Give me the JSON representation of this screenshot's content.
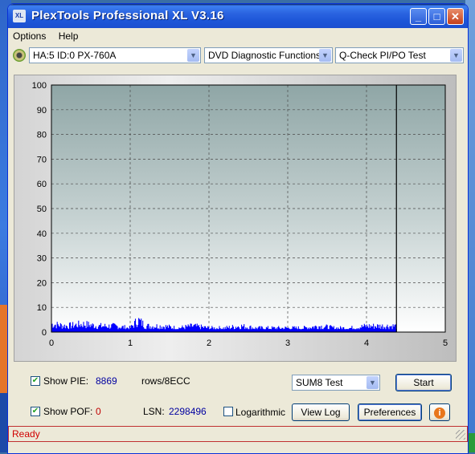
{
  "window": {
    "title": "PlexTools Professional XL V3.16",
    "title_icon": "XL"
  },
  "menu": [
    "Options",
    "Help"
  ],
  "toolbar": {
    "drive": "HA:5 ID:0  PX-760A",
    "functions": "DVD Diagnostic Functions",
    "test": "Q-Check PI/PO Test"
  },
  "chart_data": {
    "type": "line",
    "title": "",
    "xlabel": "",
    "ylabel": "",
    "xlim": [
      0,
      5
    ],
    "ylim": [
      0,
      100
    ],
    "x_ticks": [
      "0",
      "1",
      "2",
      "3",
      "4",
      "5"
    ],
    "y_ticks": [
      "0",
      "10",
      "20",
      "30",
      "40",
      "50",
      "60",
      "70",
      "80",
      "90",
      "100"
    ],
    "grid": true,
    "end_marker_x": 4.38,
    "series": [
      {
        "color": "#0000ff",
        "x_range": [
          0,
          4.38
        ],
        "typical_value": 2.5,
        "peak_value": 6,
        "x": [
          0.0,
          0.2,
          0.4,
          0.6,
          0.8,
          1.0,
          1.1,
          1.2,
          1.4,
          1.6,
          1.8,
          2.0,
          2.2,
          2.4,
          2.6,
          2.8,
          3.0,
          3.2,
          3.4,
          3.6,
          3.8,
          4.0,
          4.2,
          4.38
        ],
        "values": [
          4,
          3,
          4,
          3,
          3,
          2,
          6,
          3,
          3,
          2,
          3,
          2,
          2,
          3,
          2,
          2,
          2,
          2,
          3,
          2,
          2,
          3,
          3,
          3
        ]
      }
    ]
  },
  "controls": {
    "show_pie_label": "Show PIE:",
    "pie_value": "8869",
    "pie_unit": "rows/8ECC",
    "show_pof_label": "Show POF:",
    "pof_value": "0",
    "lsn_label": "LSN:",
    "lsn_value": "2298496",
    "logarithmic_label": "Logarithmic",
    "sum_test": "SUM8 Test",
    "start": "Start",
    "view_log": "View Log",
    "preferences": "Preferences"
  },
  "status": "Ready",
  "colors": {
    "status_text": "#d00000",
    "value_blue": "#0000a0",
    "value_red": "#c00000",
    "plot_line": "#0000ff"
  }
}
